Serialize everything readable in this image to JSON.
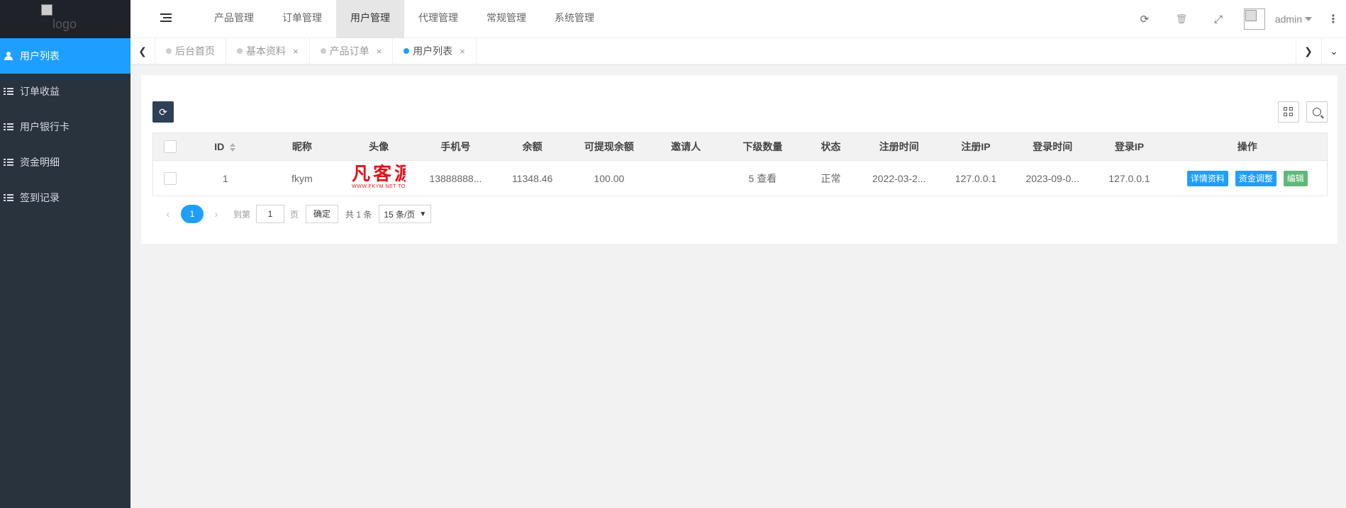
{
  "logo": {
    "alt": "logo"
  },
  "sidebar": {
    "items": [
      {
        "label": "用户列表",
        "icon": "users-icon",
        "active": true
      },
      {
        "label": "订单收益",
        "icon": "list-icon"
      },
      {
        "label": "用户银行卡",
        "icon": "list-icon"
      },
      {
        "label": "资金明细",
        "icon": "list-icon"
      },
      {
        "label": "签到记录",
        "icon": "list-icon"
      }
    ]
  },
  "header": {
    "nav": [
      {
        "label": "产品管理"
      },
      {
        "label": "订单管理"
      },
      {
        "label": "用户管理",
        "active": true
      },
      {
        "label": "代理管理"
      },
      {
        "label": "常规管理"
      },
      {
        "label": "系统管理"
      }
    ],
    "icons": {
      "refresh": "⟳",
      "clear": "🗑",
      "fullscreen": "⤢",
      "more": "⋮"
    },
    "user": {
      "name": "admin"
    }
  },
  "tabs": [
    {
      "label": "后台首页",
      "closable": false
    },
    {
      "label": "基本资料",
      "closable": true
    },
    {
      "label": "产品订单",
      "closable": true
    },
    {
      "label": "用户列表",
      "closable": true,
      "active": true
    }
  ],
  "tab_close_glyph": "×",
  "table": {
    "columns": [
      "ID",
      "昵称",
      "头像",
      "手机号",
      "余额",
      "可提现余额",
      "邀请人",
      "下级数量",
      "状态",
      "注册时间",
      "注册IP",
      "登录时间",
      "登录IP",
      "操作"
    ],
    "rows": [
      {
        "id": "1",
        "nickname": "fkym",
        "avatar_big": "凡客源",
        "avatar_small": "WWW.FKYM.NET  TO",
        "phone": "13888888...",
        "balance": "11348.46",
        "withdrawable": "100.00",
        "inviter": "",
        "sub_count": "5",
        "sub_view": "查看",
        "status": "正常",
        "reg_time": "2022-03-2...",
        "reg_ip": "127.0.0.1",
        "login_time": "2023-09-0...",
        "login_ip": "127.0.0.1",
        "actions": [
          "详情资料",
          "资金调整",
          "编辑"
        ]
      }
    ]
  },
  "pager": {
    "current": "1",
    "goto_label": "到第",
    "page_value": "1",
    "page_unit": "页",
    "confirm": "确定",
    "total": "共 1 条",
    "page_size": "15 条/页"
  },
  "colors": {
    "accent": "#1e9fff",
    "sidebar": "#28333e",
    "green": "#5fb878",
    "dark_btn": "#2f4056"
  }
}
